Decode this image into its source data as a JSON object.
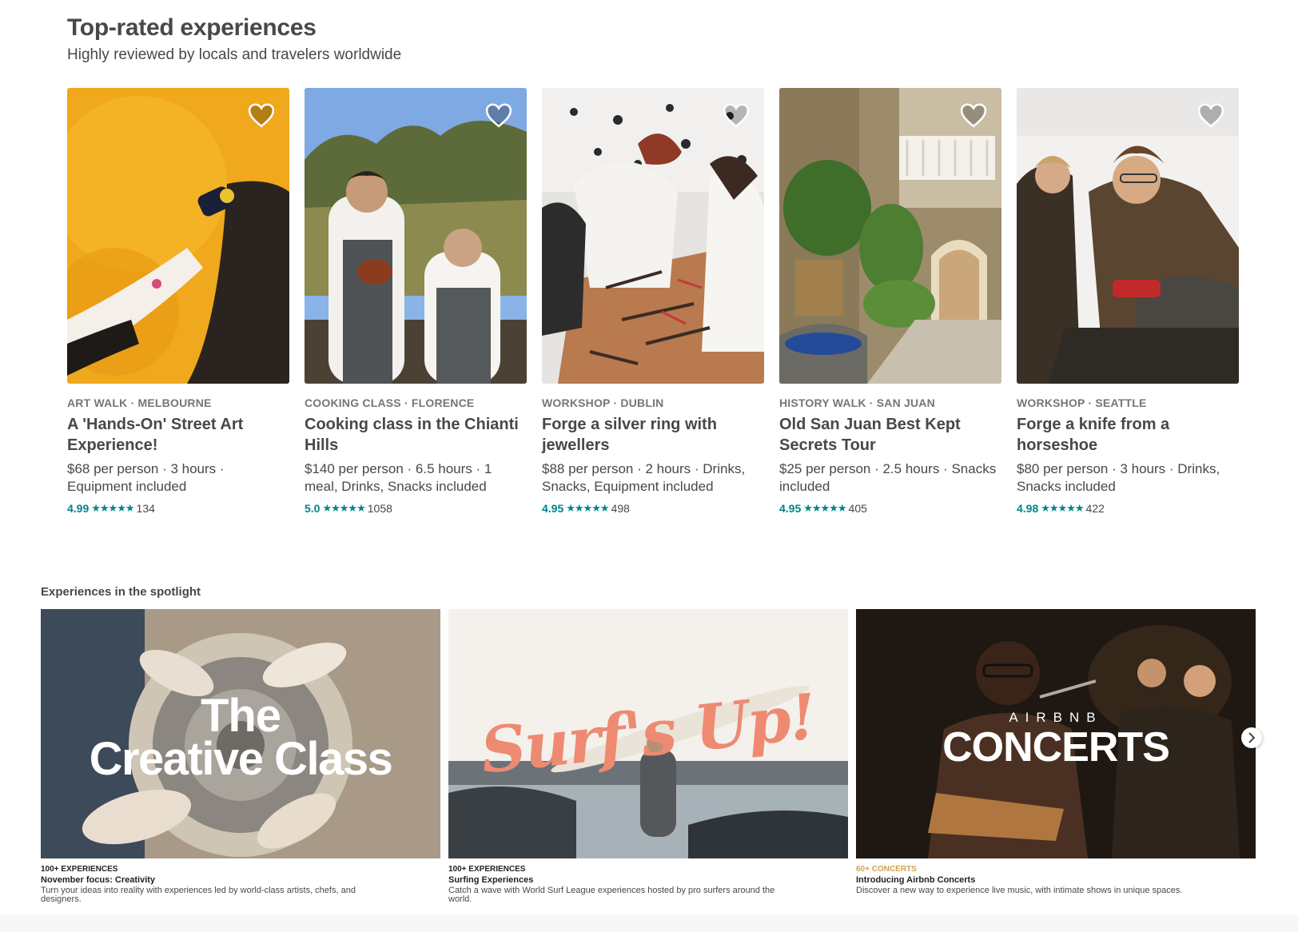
{
  "section": {
    "title": "Top-rated experiences",
    "subtitle": "Highly reviewed by locals and travelers worldwide"
  },
  "cards": [
    {
      "kicker": "ART WALK · MELBOURNE",
      "title": "A 'Hands-On' Street Art Experience!",
      "meta": "$68 per person · 3 hours · Equipment included",
      "rating": "4.99",
      "stars": "★★★★★",
      "reviews": "134"
    },
    {
      "kicker": "COOKING CLASS · FLORENCE",
      "title": "Cooking class in the Chianti Hills",
      "meta": "$140 per person · 6.5 hours · 1 meal, Drinks, Snacks included",
      "rating": "5.0",
      "stars": "★★★★★",
      "reviews": "1058"
    },
    {
      "kicker": "WORKSHOP · DUBLIN",
      "title": "Forge a silver ring with jewellers",
      "meta": "$88 per person · 2 hours · Drinks, Snacks, Equipment included",
      "rating": "4.95",
      "stars": "★★★★★",
      "reviews": "498"
    },
    {
      "kicker": "HISTORY WALK · SAN JUAN",
      "title": "Old San Juan Best Kept Secrets Tour",
      "meta": "$25 per person · 2.5 hours · Snacks included",
      "rating": "4.95",
      "stars": "★★★★★",
      "reviews": "405"
    },
    {
      "kicker": "WORKSHOP · SEATTLE",
      "title": "Forge a knife from a horseshoe",
      "meta": "$80 per person · 3 hours · Drinks, Snacks included",
      "rating": "4.98",
      "stars": "★★★★★",
      "reviews": "422"
    }
  ],
  "spotlight": {
    "title": "Experiences in the spotlight",
    "items": [
      {
        "overlay_line1": "The",
        "overlay_line2": "Creative Class",
        "kicker": "100+ EXPERIENCES",
        "name": "November focus: Creativity",
        "desc": "Turn your ideas into reality with experiences led by world-class artists, chefs, and designers."
      },
      {
        "overlay": "Surf's Up!",
        "kicker": "100+ EXPERIENCES",
        "name": "Surfing Experiences",
        "desc": "Catch a wave with World Surf League experiences hosted by pro surfers around the world."
      },
      {
        "overlay_small": "AIRBNB",
        "overlay": "CONCERTS",
        "kicker": "60+ CONCERTS",
        "name": "Introducing Airbnb Concerts",
        "desc": "Discover a new way to experience live music, with intimate shows in unique spaces."
      }
    ]
  },
  "icons": {
    "heart": "heart-icon",
    "next": "chevron-right-icon"
  },
  "colors": {
    "teal": "#008489",
    "text": "#484848",
    "gold": "#d0a24c"
  }
}
